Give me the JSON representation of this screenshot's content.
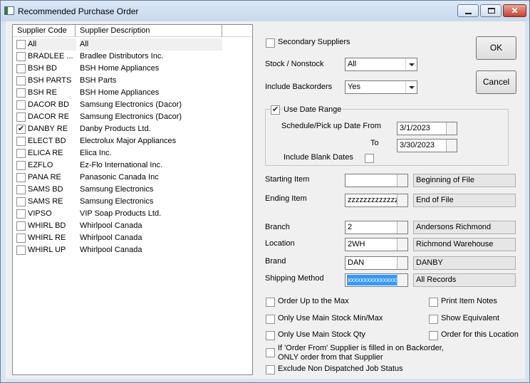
{
  "window": {
    "title": "Recommended Purchase Order"
  },
  "supplier_list": {
    "headers": [
      "Supplier Code",
      "Supplier Description"
    ],
    "rows": [
      {
        "code": "All",
        "description": "All",
        "checked": false
      },
      {
        "code": "BRADLEE ...",
        "description": "Bradlee Distributors Inc.",
        "checked": false
      },
      {
        "code": "BSH BD",
        "description": "BSH Home Appliances",
        "checked": false
      },
      {
        "code": "BSH PARTS",
        "description": "BSH Parts",
        "checked": false
      },
      {
        "code": "BSH RE",
        "description": "BSH Home Appliances",
        "checked": false
      },
      {
        "code": "DACOR BD",
        "description": "Samsung Electronics (Dacor)",
        "checked": false
      },
      {
        "code": "DACOR RE",
        "description": "Samsung Electronics (Dacor)",
        "checked": false
      },
      {
        "code": "DANBY RE",
        "description": "Danby Products Ltd.",
        "checked": true
      },
      {
        "code": "ELECT BD",
        "description": "Electrolux Major Appliances",
        "checked": false
      },
      {
        "code": "ELICA RE",
        "description": "Elica Inc.",
        "checked": false
      },
      {
        "code": "EZFLO",
        "description": "Ez-Flo International Inc.",
        "checked": false
      },
      {
        "code": "PANA RE",
        "description": "Panasonic Canada Inc",
        "checked": false
      },
      {
        "code": "SAMS BD",
        "description": "Samsung Electronics",
        "checked": false
      },
      {
        "code": "SAMS RE",
        "description": "Samsung Electronics",
        "checked": false
      },
      {
        "code": "VIPSO",
        "description": "VIP Soap Products Ltd.",
        "checked": false
      },
      {
        "code": "WHIRL BD",
        "description": "Whirlpool Canada",
        "checked": false
      },
      {
        "code": "WHIRL RE",
        "description": "Whirlpool Canada",
        "checked": false
      },
      {
        "code": "WHIRL UP",
        "description": "Whirlpool Canada",
        "checked": false
      }
    ]
  },
  "options": {
    "secondary_suppliers": "Secondary Suppliers",
    "stock_nonstock_label": "Stock / Nonstock",
    "stock_nonstock_value": "All",
    "include_backorders_label": "Include Backorders",
    "include_backorders_value": "Yes"
  },
  "date_range": {
    "use_label": "Use Date Range",
    "use_checked": true,
    "from_label": "Schedule/Pick up Date From",
    "from_value": "3/1/2023",
    "to_label": "To",
    "to_value": "3/30/2023",
    "blank_label": "Include Blank Dates"
  },
  "items": {
    "starting_label": "Starting Item",
    "starting_value": "",
    "starting_desc": "Beginning of File",
    "ending_label": "Ending Item",
    "ending_value": "zzzzzzzzzzzzzzz",
    "ending_desc": "End of File"
  },
  "filters": {
    "branch_label": "Branch",
    "branch_value": "2",
    "branch_desc": "Andersons Richmond",
    "location_label": "Location",
    "location_value": "2WH",
    "location_desc": "Richmond Warehouse",
    "brand_label": "Brand",
    "brand_value": "DAN",
    "brand_desc": "DANBY",
    "shipping_label": "Shipping Method",
    "shipping_value": "xxxxxxxxxxxxxxxxx",
    "shipping_desc": "All Records"
  },
  "checks": {
    "order_up": "Order Up to the Max",
    "main_minmax": "Only Use Main Stock Min/Max",
    "main_qty": "Only Use Main Stock Qty",
    "order_from_1": "If 'Order From' Supplier is filled in on Backorder,",
    "order_from_2": "ONLY order from that Supplier",
    "exclude_nondispatched": "Exclude Non Dispatched Job Status",
    "print_notes": "Print Item Notes",
    "show_equivalent": "Show Equivalent",
    "order_location": "Order for this Location"
  },
  "buttons": {
    "ok": "OK",
    "cancel": "Cancel"
  }
}
